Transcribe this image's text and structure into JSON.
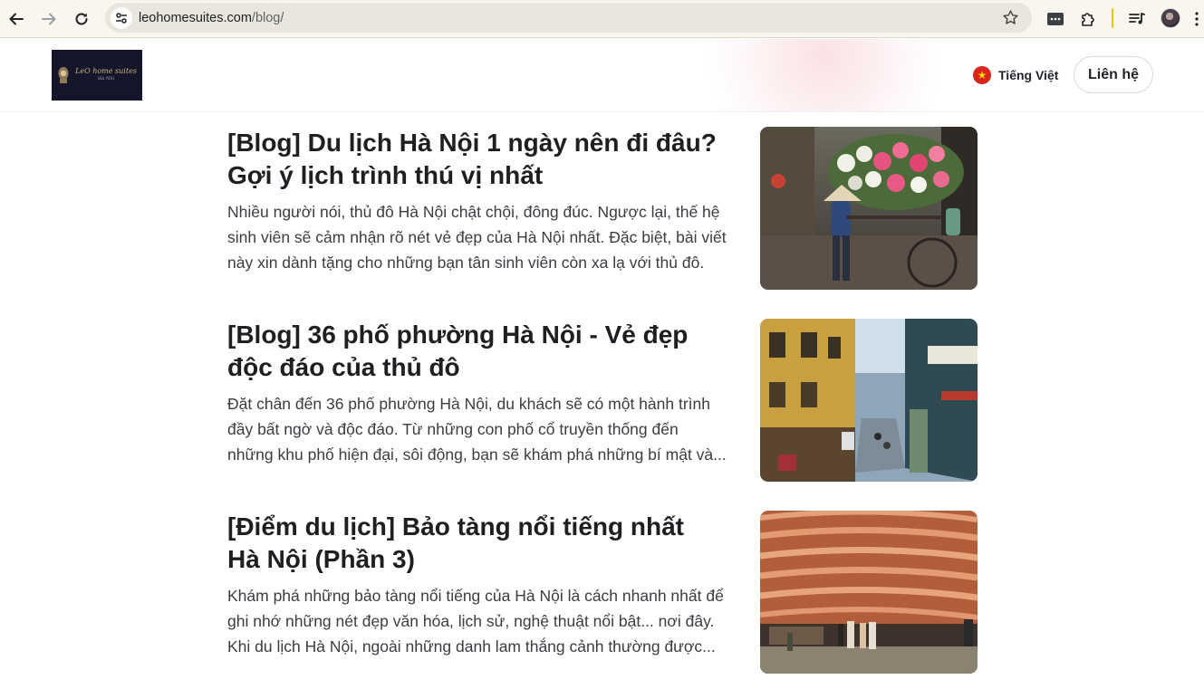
{
  "browser": {
    "url_domain": "leohomesuites.com",
    "url_path": "/blog/"
  },
  "header": {
    "logo_text": "LeO home suites",
    "logo_sub": "Hà Nội",
    "language_label": "Tiếng Việt",
    "contact_label": "Liên hệ"
  },
  "posts": [
    {
      "title_line1": "[Blog] Du lịch Hà Nội 1 ngày nên đi đâu?",
      "title_line2": "Gợi ý lịch trình thú vị nhất",
      "excerpt_line1": "Nhiều người nói, thủ đô Hà Nội chật chội, đông đúc. Ngược lại, thế hệ",
      "excerpt_line2": "sinh viên sẽ cảm nhận rõ nét vẻ đẹp của Hà Nội nhất. Đặc biệt, bài viết",
      "excerpt_line3": "này xin dành tặng cho những bạn tân sinh viên còn xa lạ với thủ đô."
    },
    {
      "title_line1": "[Blog] 36 phố phường Hà Nội - Vẻ đẹp",
      "title_line2": "độc đáo của thủ đô",
      "excerpt_line1": "Đặt chân đến 36 phố phường Hà Nội, du khách sẽ có một hành trình",
      "excerpt_line2": "đầy bất ngờ và độc đáo. Từ những con phố cổ truyền thống đến",
      "excerpt_line3": "những khu phố hiện đại, sôi động, bạn sẽ khám phá những bí mật và..."
    },
    {
      "title_line1": "[Điểm du lịch] Bảo tàng nổi tiếng nhất",
      "title_line2": "Hà Nội (Phần 3)",
      "excerpt_line1": "Khám phá những bảo tàng nổi tiếng của Hà Nội là cách nhanh nhất để",
      "excerpt_line2": "ghi nhớ những nét đẹp văn hóa, lịch sử, nghệ thuật nổi bật... nơi đây.",
      "excerpt_line3": "Khi du lịch Hà Nội, ngoài những danh lam thắng cảnh thường được..."
    }
  ],
  "icons": {
    "back": "back-arrow-icon",
    "forward": "forward-arrow-icon",
    "reload": "reload-icon",
    "site_info": "tune-icon",
    "bookmark": "star-icon",
    "extension1": "password-manager-icon",
    "extension2": "puzzle-icon",
    "media": "media-queue-icon",
    "menu": "kebab-menu-icon"
  },
  "colors": {
    "toolbar_bg": "#f8f6ee",
    "omnibox_bg": "#e9e6dd",
    "flag_red": "#da251d",
    "flag_star": "#ffd700",
    "logo_bg": "#15162a",
    "title_text": "#1d1f22"
  }
}
